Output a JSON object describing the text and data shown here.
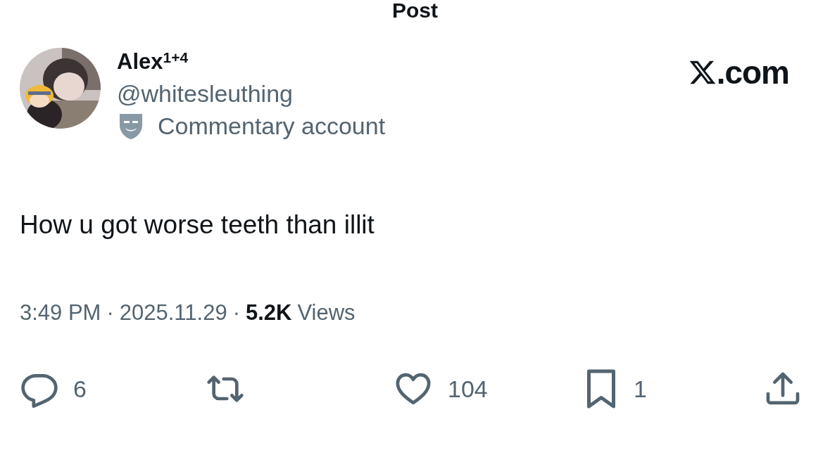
{
  "header": {
    "title": "Post"
  },
  "author": {
    "name": "Alex$^{1+4}$",
    "handle": "@whitesleuthing",
    "label": "Commentary account"
  },
  "brand": {
    "text": ".com"
  },
  "post": {
    "text": "How u got worse teeth than illit"
  },
  "meta": {
    "time": "3:49 PM",
    "separator_1": "·",
    "date": "2025.11.29",
    "separator_2": "·",
    "views_count": "5.2K",
    "views_label": "Views"
  },
  "actions": [
    {
      "kind": "reply",
      "count": "6"
    },
    {
      "kind": "repost"
    },
    {
      "kind": "like",
      "count": "104"
    },
    {
      "kind": "bookmark",
      "count": "1"
    },
    {
      "kind": "share"
    }
  ]
}
